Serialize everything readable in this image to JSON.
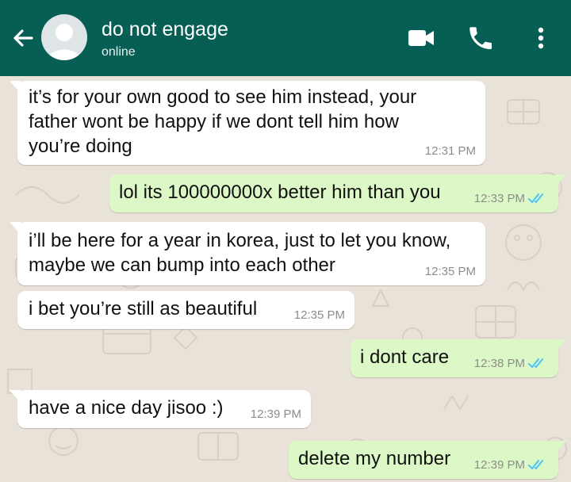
{
  "header": {
    "contact_name": "do not engage",
    "status": "online"
  },
  "colors": {
    "header": "#075e54",
    "wallpaper": "#e9e2d9",
    "incoming_bubble": "#ffffff",
    "outgoing_bubble": "#dcf8c6",
    "read_ticks": "#4fc3f7"
  },
  "icons": {
    "back": "arrow-left-icon",
    "avatar": "default-avatar-icon",
    "video": "video-call-icon",
    "call": "phone-icon",
    "menu": "more-vertical-icon",
    "read": "double-check-icon"
  },
  "messages": [
    {
      "direction": "in",
      "lines": [
        "it’s for your own good to see him instead, your",
        "father wont be happy if we dont tell him how",
        "you’re doing"
      ],
      "time": "12:31 PM"
    },
    {
      "direction": "out",
      "lines": [
        "lol its 100000000x better him than you"
      ],
      "time": "12:33 PM",
      "read": true
    },
    {
      "direction": "in",
      "lines": [
        "i’ll be here for a year in korea, just to let you know,",
        "maybe we can bump into each other"
      ],
      "time": "12:35 PM"
    },
    {
      "direction": "in",
      "lines": [
        "i bet you’re still as beautiful"
      ],
      "time": "12:35 PM"
    },
    {
      "direction": "out",
      "lines": [
        "i dont care"
      ],
      "time": "12:38 PM",
      "read": true
    },
    {
      "direction": "in",
      "lines": [
        "have a nice day jisoo :)"
      ],
      "time": "12:39 PM"
    },
    {
      "direction": "out",
      "lines": [
        "delete my number"
      ],
      "time": "12:39 PM",
      "read": true
    }
  ]
}
